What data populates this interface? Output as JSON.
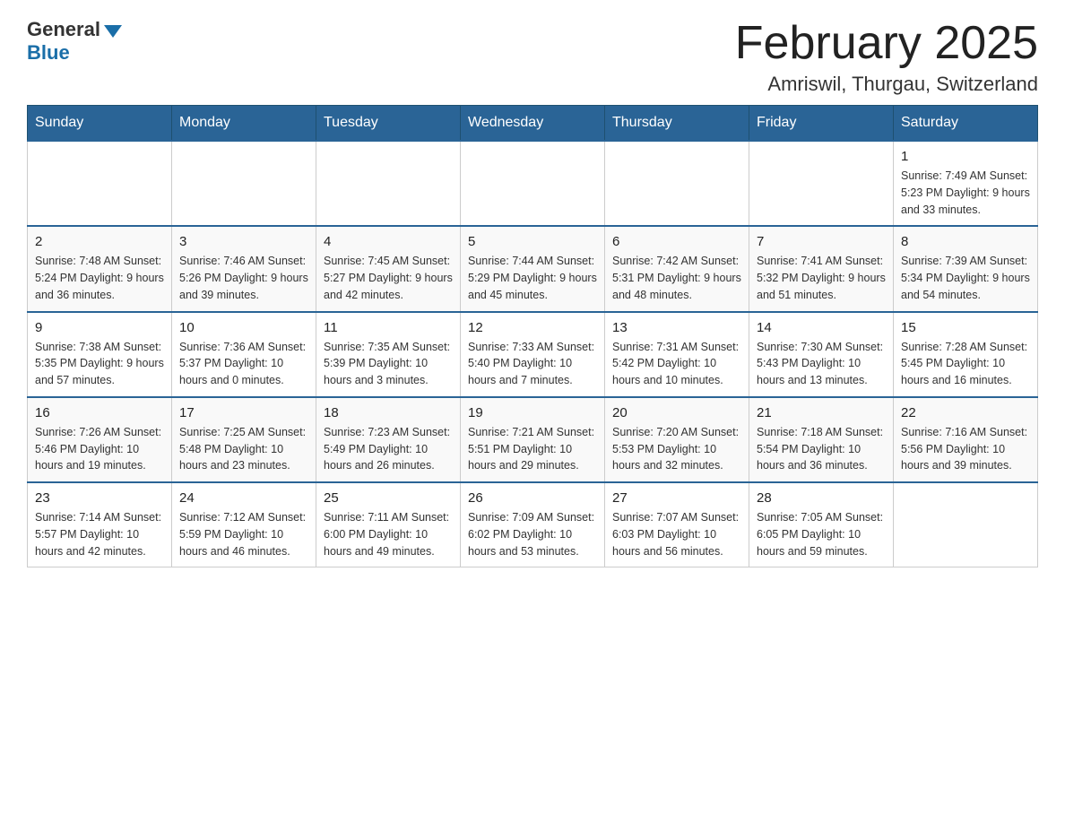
{
  "header": {
    "logo_general": "General",
    "logo_blue": "Blue",
    "month_title": "February 2025",
    "location": "Amriswil, Thurgau, Switzerland"
  },
  "weekdays": [
    "Sunday",
    "Monday",
    "Tuesday",
    "Wednesday",
    "Thursday",
    "Friday",
    "Saturday"
  ],
  "weeks": [
    {
      "days": [
        {
          "number": "",
          "info": ""
        },
        {
          "number": "",
          "info": ""
        },
        {
          "number": "",
          "info": ""
        },
        {
          "number": "",
          "info": ""
        },
        {
          "number": "",
          "info": ""
        },
        {
          "number": "",
          "info": ""
        },
        {
          "number": "1",
          "info": "Sunrise: 7:49 AM\nSunset: 5:23 PM\nDaylight: 9 hours and 33 minutes."
        }
      ]
    },
    {
      "days": [
        {
          "number": "2",
          "info": "Sunrise: 7:48 AM\nSunset: 5:24 PM\nDaylight: 9 hours and 36 minutes."
        },
        {
          "number": "3",
          "info": "Sunrise: 7:46 AM\nSunset: 5:26 PM\nDaylight: 9 hours and 39 minutes."
        },
        {
          "number": "4",
          "info": "Sunrise: 7:45 AM\nSunset: 5:27 PM\nDaylight: 9 hours and 42 minutes."
        },
        {
          "number": "5",
          "info": "Sunrise: 7:44 AM\nSunset: 5:29 PM\nDaylight: 9 hours and 45 minutes."
        },
        {
          "number": "6",
          "info": "Sunrise: 7:42 AM\nSunset: 5:31 PM\nDaylight: 9 hours and 48 minutes."
        },
        {
          "number": "7",
          "info": "Sunrise: 7:41 AM\nSunset: 5:32 PM\nDaylight: 9 hours and 51 minutes."
        },
        {
          "number": "8",
          "info": "Sunrise: 7:39 AM\nSunset: 5:34 PM\nDaylight: 9 hours and 54 minutes."
        }
      ]
    },
    {
      "days": [
        {
          "number": "9",
          "info": "Sunrise: 7:38 AM\nSunset: 5:35 PM\nDaylight: 9 hours and 57 minutes."
        },
        {
          "number": "10",
          "info": "Sunrise: 7:36 AM\nSunset: 5:37 PM\nDaylight: 10 hours and 0 minutes."
        },
        {
          "number": "11",
          "info": "Sunrise: 7:35 AM\nSunset: 5:39 PM\nDaylight: 10 hours and 3 minutes."
        },
        {
          "number": "12",
          "info": "Sunrise: 7:33 AM\nSunset: 5:40 PM\nDaylight: 10 hours and 7 minutes."
        },
        {
          "number": "13",
          "info": "Sunrise: 7:31 AM\nSunset: 5:42 PM\nDaylight: 10 hours and 10 minutes."
        },
        {
          "number": "14",
          "info": "Sunrise: 7:30 AM\nSunset: 5:43 PM\nDaylight: 10 hours and 13 minutes."
        },
        {
          "number": "15",
          "info": "Sunrise: 7:28 AM\nSunset: 5:45 PM\nDaylight: 10 hours and 16 minutes."
        }
      ]
    },
    {
      "days": [
        {
          "number": "16",
          "info": "Sunrise: 7:26 AM\nSunset: 5:46 PM\nDaylight: 10 hours and 19 minutes."
        },
        {
          "number": "17",
          "info": "Sunrise: 7:25 AM\nSunset: 5:48 PM\nDaylight: 10 hours and 23 minutes."
        },
        {
          "number": "18",
          "info": "Sunrise: 7:23 AM\nSunset: 5:49 PM\nDaylight: 10 hours and 26 minutes."
        },
        {
          "number": "19",
          "info": "Sunrise: 7:21 AM\nSunset: 5:51 PM\nDaylight: 10 hours and 29 minutes."
        },
        {
          "number": "20",
          "info": "Sunrise: 7:20 AM\nSunset: 5:53 PM\nDaylight: 10 hours and 32 minutes."
        },
        {
          "number": "21",
          "info": "Sunrise: 7:18 AM\nSunset: 5:54 PM\nDaylight: 10 hours and 36 minutes."
        },
        {
          "number": "22",
          "info": "Sunrise: 7:16 AM\nSunset: 5:56 PM\nDaylight: 10 hours and 39 minutes."
        }
      ]
    },
    {
      "days": [
        {
          "number": "23",
          "info": "Sunrise: 7:14 AM\nSunset: 5:57 PM\nDaylight: 10 hours and 42 minutes."
        },
        {
          "number": "24",
          "info": "Sunrise: 7:12 AM\nSunset: 5:59 PM\nDaylight: 10 hours and 46 minutes."
        },
        {
          "number": "25",
          "info": "Sunrise: 7:11 AM\nSunset: 6:00 PM\nDaylight: 10 hours and 49 minutes."
        },
        {
          "number": "26",
          "info": "Sunrise: 7:09 AM\nSunset: 6:02 PM\nDaylight: 10 hours and 53 minutes."
        },
        {
          "number": "27",
          "info": "Sunrise: 7:07 AM\nSunset: 6:03 PM\nDaylight: 10 hours and 56 minutes."
        },
        {
          "number": "28",
          "info": "Sunrise: 7:05 AM\nSunset: 6:05 PM\nDaylight: 10 hours and 59 minutes."
        },
        {
          "number": "",
          "info": ""
        }
      ]
    }
  ]
}
